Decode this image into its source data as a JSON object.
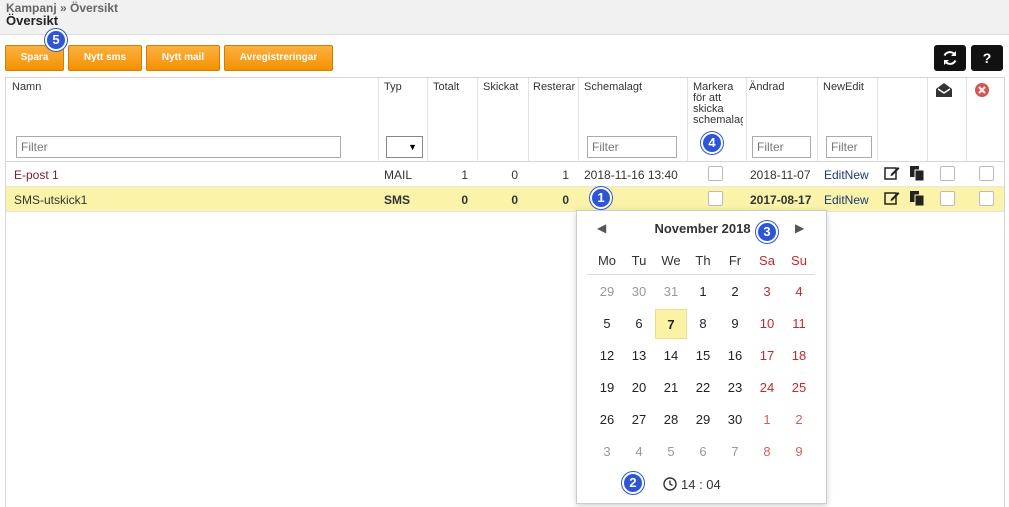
{
  "breadcrumb": "Kampanj » Översikt",
  "page_title": "Översikt",
  "toolbar": {
    "buttons": [
      "Spara",
      "Nytt sms",
      "Nytt mail",
      "Avregistreringar"
    ],
    "help_label": "?"
  },
  "columns": {
    "name": "Namn",
    "type": "Typ",
    "total": "Totalt",
    "sent": "Skickat",
    "remaining": "Resterar",
    "scheduled": "Schemalagt",
    "mark": "Markera för att skicka schemalagt",
    "changed": "Ändrad",
    "newedit": "NewEdit"
  },
  "filter_placeholder": "Filter",
  "rows": [
    {
      "name": "E-post 1",
      "type": "MAIL",
      "total": "1",
      "sent": "0",
      "remaining": "1",
      "scheduled": "2018-11-16 13:40",
      "changed": "2018-11-07",
      "newedit": "EditNew"
    },
    {
      "name": "SMS-utskick1",
      "type": "SMS",
      "total": "0",
      "sent": "0",
      "remaining": "0",
      "scheduled": "",
      "changed": "2017-08-17",
      "newedit": "EditNew"
    }
  ],
  "calendar": {
    "month_title": "November 2018",
    "weekdays": [
      "Mo",
      "Tu",
      "We",
      "Th",
      "Fr",
      "Sa",
      "Su"
    ],
    "weeks": [
      [
        "29",
        "30",
        "31",
        "1",
        "2",
        "3",
        "4"
      ],
      [
        "5",
        "6",
        "7",
        "8",
        "9",
        "10",
        "11"
      ],
      [
        "12",
        "13",
        "14",
        "15",
        "16",
        "17",
        "18"
      ],
      [
        "19",
        "20",
        "21",
        "22",
        "23",
        "24",
        "25"
      ],
      [
        "26",
        "27",
        "28",
        "29",
        "30",
        "1",
        "2"
      ],
      [
        "3",
        "4",
        "5",
        "6",
        "7",
        "8",
        "9"
      ]
    ],
    "today": "7",
    "time": "14 : 04"
  },
  "badges": [
    "1",
    "2",
    "3",
    "4",
    "5"
  ],
  "colors": {
    "accent_orange": "#f39200",
    "selected_row": "#faf3a9",
    "badge_blue": "#2d55d6",
    "weekend_red": "#c62828"
  },
  "icons": [
    "refresh-icon",
    "help-icon",
    "edit-icon",
    "copy-icon",
    "mail-open-icon",
    "delete-icon",
    "clock-icon",
    "prev-arrow-icon",
    "next-arrow-icon"
  ]
}
